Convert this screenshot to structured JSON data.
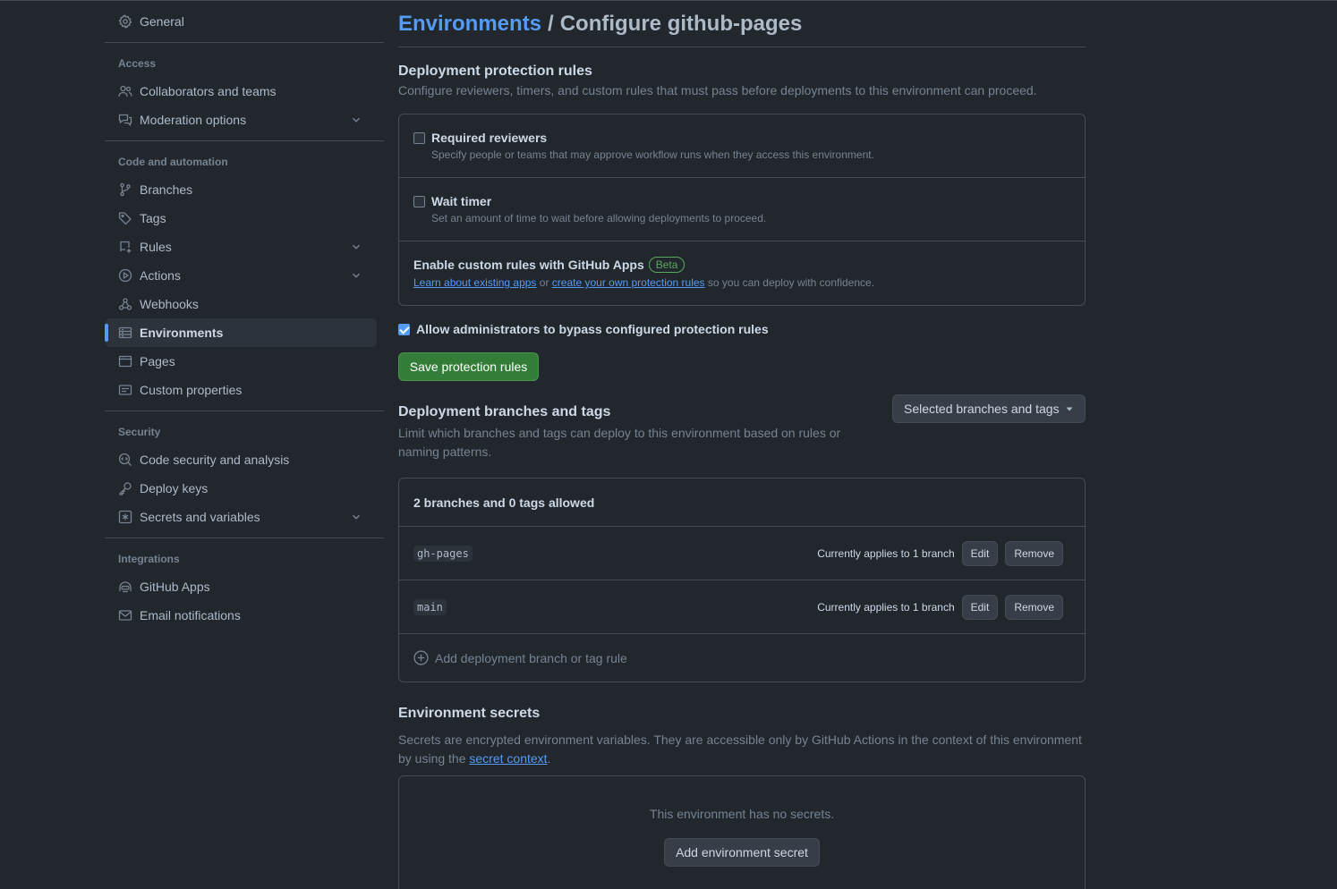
{
  "sidebar": {
    "general": "General",
    "access": {
      "heading": "Access",
      "items": [
        "Collaborators and teams",
        "Moderation options"
      ]
    },
    "code": {
      "heading": "Code and automation",
      "items": [
        "Branches",
        "Tags",
        "Rules",
        "Actions",
        "Webhooks",
        "Environments",
        "Pages",
        "Custom properties"
      ]
    },
    "security": {
      "heading": "Security",
      "items": [
        "Code security and analysis",
        "Deploy keys",
        "Secrets and variables"
      ]
    },
    "integrations": {
      "heading": "Integrations",
      "items": [
        "GitHub Apps",
        "Email notifications"
      ]
    },
    "active": "Environments"
  },
  "header": {
    "breadcrumb_link": "Environments",
    "separator": "/",
    "title": "Configure github-pages"
  },
  "protection": {
    "title": "Deployment protection rules",
    "description": "Configure reviewers, timers, and custom rules that must pass before deployments to this environment can proceed.",
    "rules": [
      {
        "label": "Required reviewers",
        "description": "Specify people or teams that may approve workflow runs when they access this environment.",
        "checked": false
      },
      {
        "label": "Wait timer",
        "description": "Set an amount of time to wait before allowing deployments to proceed.",
        "checked": false
      }
    ],
    "custom": {
      "label": "Enable custom rules with GitHub Apps",
      "badge": "Beta",
      "link1": "Learn about existing apps",
      "or": "or",
      "link2": "create your own protection rules",
      "suffix": "so you can deploy with confidence."
    },
    "bypass_label": "Allow administrators to bypass configured protection rules",
    "bypass_checked": true,
    "save_label": "Save protection rules"
  },
  "branches": {
    "title": "Deployment branches and tags",
    "description": "Limit which branches and tags can deploy to this environment based on rules or naming patterns.",
    "dropdown": "Selected branches and tags",
    "summary": "2 branches and 0 tags allowed",
    "rows": [
      {
        "name": "gh-pages",
        "applies": "Currently applies to 1 branch",
        "edit": "Edit",
        "remove": "Remove"
      },
      {
        "name": "main",
        "applies": "Currently applies to 1 branch",
        "edit": "Edit",
        "remove": "Remove"
      }
    ],
    "add_label": "Add deployment branch or tag rule"
  },
  "secrets": {
    "title": "Environment secrets",
    "description_pre": "Secrets are encrypted environment variables. They are accessible only by GitHub Actions in the context of this environment by using the",
    "description_link": "secret context",
    "description_post": ".",
    "empty": "This environment has no secrets.",
    "add_label": "Add environment secret"
  },
  "colors": {
    "background": "#22272e",
    "accent": "#539bf5",
    "primary_button": "#347d39",
    "border": "#444c56"
  }
}
